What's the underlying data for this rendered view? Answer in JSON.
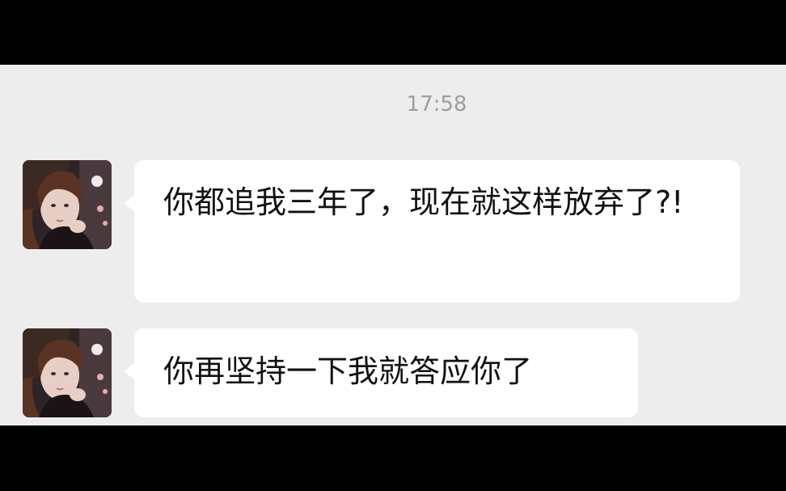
{
  "chat": {
    "timestamp": "17:58",
    "messages": [
      {
        "text": "你都追我三年了，现在就这样放弃了?!"
      },
      {
        "text": "你再坚持一下我就答应你了"
      }
    ]
  },
  "colors": {
    "background": "#ededed",
    "bubble": "#ffffff",
    "timestamp": "#9d9d9d",
    "letterbox": "#000000"
  },
  "icons": {
    "avatar": "contact-avatar"
  }
}
